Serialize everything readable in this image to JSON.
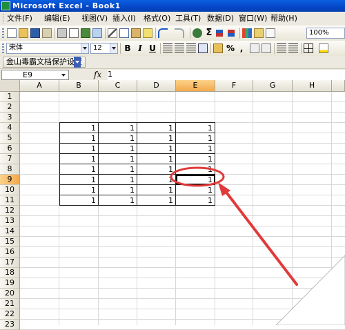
{
  "window": {
    "title": "Microsoft Excel - Book1"
  },
  "menu": [
    "文件(F)",
    "编辑(E)",
    "视图(V)",
    "插入(I)",
    "格式(O)",
    "工具(T)",
    "数据(D)",
    "窗口(W)",
    "帮助(H)"
  ],
  "toolbar": {
    "zoom": "100%",
    "font_name": "宋体",
    "font_size": "12",
    "bold": "B",
    "italic": "I",
    "underline": "U",
    "percent": "%",
    "comma": ","
  },
  "protect_toolbar": {
    "label": "金山毒霸文档保护设置"
  },
  "formula_bar": {
    "name_box": "E9",
    "fx": "fx",
    "value": "1"
  },
  "columns": [
    "A",
    "B",
    "C",
    "D",
    "E",
    "F",
    "G",
    "H"
  ],
  "rows": [
    "1",
    "2",
    "3",
    "4",
    "5",
    "6",
    "7",
    "8",
    "9",
    "10",
    "11",
    "12",
    "13",
    "14",
    "15",
    "16",
    "17",
    "18",
    "19",
    "20",
    "21",
    "22",
    "23"
  ],
  "active_cell": {
    "column": "E",
    "row": "9"
  },
  "data_table": {
    "columns": [
      "B",
      "C",
      "D",
      "E"
    ],
    "rows": [
      {
        "row": "4",
        "values": [
          "1",
          "1",
          "1",
          "1"
        ]
      },
      {
        "row": "5",
        "values": [
          "1",
          "1",
          "1",
          "1"
        ]
      },
      {
        "row": "6",
        "values": [
          "1",
          "1",
          "1",
          "1"
        ]
      },
      {
        "row": "7",
        "values": [
          "1",
          "1",
          "1",
          "1"
        ]
      },
      {
        "row": "8",
        "values": [
          "1",
          "1",
          "1",
          "1"
        ]
      },
      {
        "row": "9",
        "values": [
          "1",
          "1",
          "1",
          "1"
        ]
      },
      {
        "row": "10",
        "values": [
          "1",
          "1",
          "1",
          "1"
        ]
      },
      {
        "row": "11",
        "values": [
          "1",
          "1",
          "1",
          "1"
        ]
      }
    ]
  },
  "colors": {
    "titlebar": "#0546c8",
    "annotation": "#e03a3a",
    "active_header": "#f3a94c"
  }
}
